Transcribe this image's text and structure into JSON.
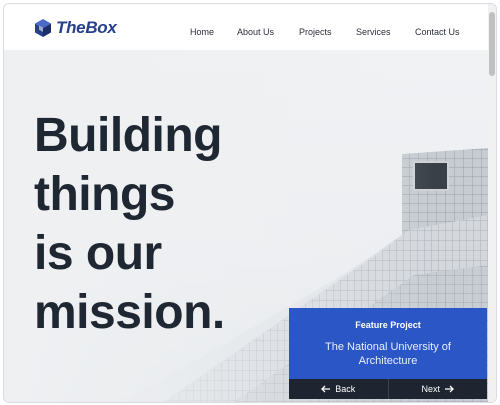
{
  "brand": {
    "name": "TheBox",
    "icon": "cube-logo-icon",
    "color": "#27408b"
  },
  "nav": {
    "items": [
      "Home",
      "About Us",
      "Projects",
      "Services",
      "Contact Us"
    ]
  },
  "hero": {
    "headline_lines": [
      "Building",
      "things",
      "is our",
      "mission."
    ]
  },
  "feature": {
    "title": "Feature Project",
    "subtitle": "The National University of Architecture",
    "back_label": "Back",
    "next_label": "Next",
    "back_icon": "arrow-left-icon",
    "next_icon": "arrow-right-icon",
    "accent": "#2a56c6"
  }
}
